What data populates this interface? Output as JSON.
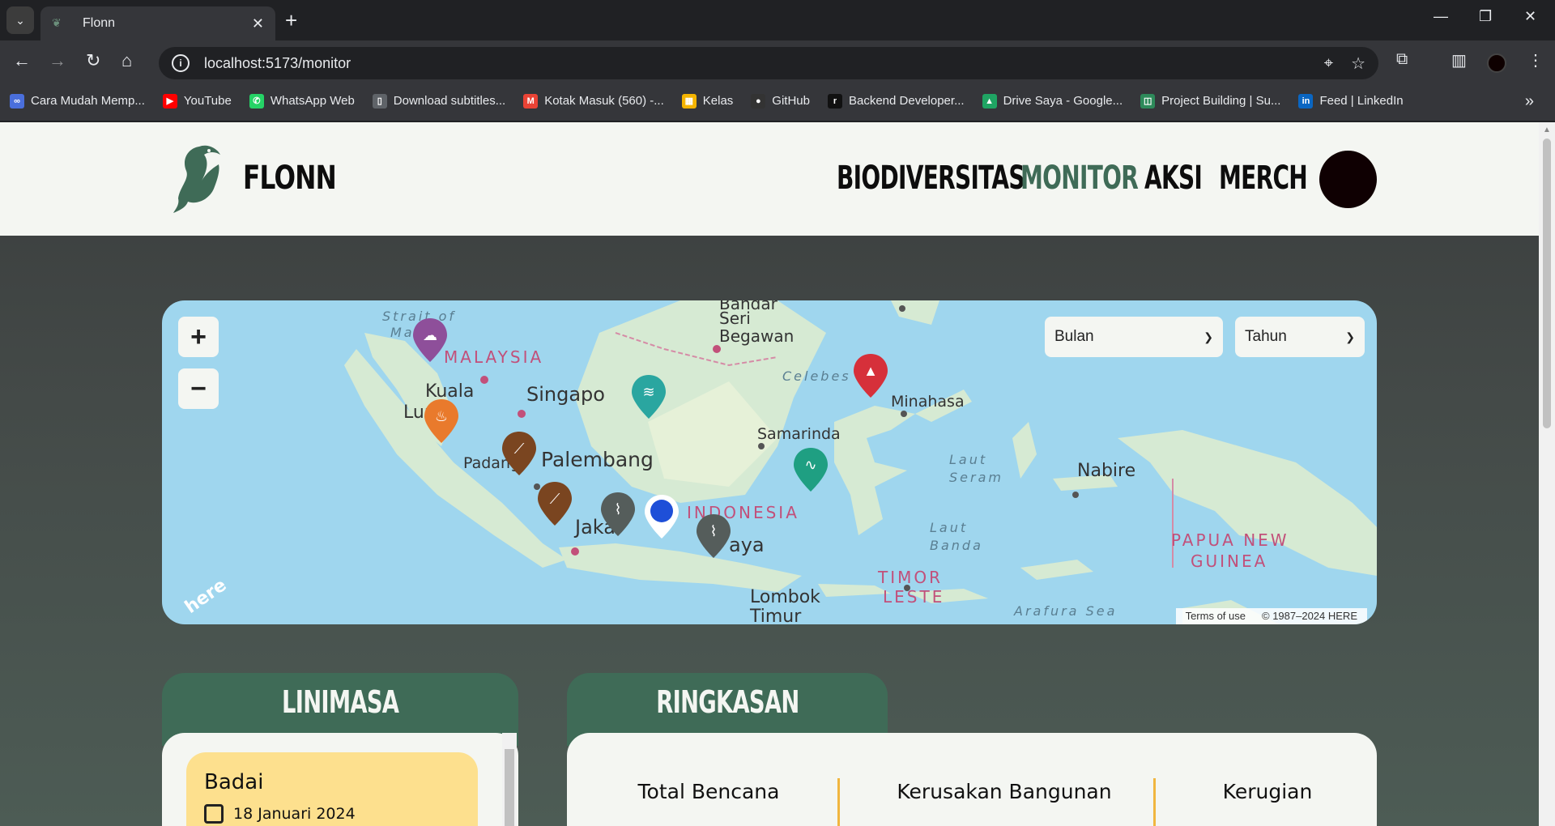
{
  "browser": {
    "tab_title": "Flonn",
    "url": "localhost:5173/monitor",
    "bookmarks": [
      {
        "label": "Cara Mudah Memp...",
        "icon": "link-icon",
        "color": "#4a6fdc"
      },
      {
        "label": "YouTube",
        "icon": "youtube-icon",
        "color": "#ff0000"
      },
      {
        "label": "WhatsApp Web",
        "icon": "whatsapp-icon",
        "color": "#25d366"
      },
      {
        "label": "Download subtitles...",
        "icon": "page-icon",
        "color": "#5f6368"
      },
      {
        "label": "Kotak Masuk (560) -...",
        "icon": "gmail-icon",
        "color": "#ea4335"
      },
      {
        "label": "Kelas",
        "icon": "classroom-icon",
        "color": "#f4b400"
      },
      {
        "label": "GitHub",
        "icon": "github-icon",
        "color": "#333333"
      },
      {
        "label": "Backend Developer...",
        "icon": "dicoding-icon",
        "color": "#111111"
      },
      {
        "label": "Drive Saya - Google...",
        "icon": "drive-icon",
        "color": "#1fa463"
      },
      {
        "label": "Project Building | Su...",
        "icon": "project-icon",
        "color": "#2d8a5a"
      },
      {
        "label": "Feed | LinkedIn",
        "icon": "linkedin-icon",
        "color": "#0a66c2"
      }
    ]
  },
  "header": {
    "brand": "FLONN",
    "nav": [
      "BIODIVERSITAS",
      "MONITOR",
      "AKSI",
      "MERCH"
    ],
    "active_nav": "MONITOR"
  },
  "map": {
    "filters": {
      "month": "Bulan",
      "year": "Tahun"
    },
    "zoom_in": "+",
    "zoom_out": "−",
    "labels": {
      "strait": "Strait of",
      "strait2": "Ma",
      "malaysia": "MALAYSIA",
      "bandar": "Bandar",
      "seri": "Seri",
      "begawan": "Begawan",
      "kuala": "Kuala",
      "lumpur": "Lum",
      "singapore": "Singapo",
      "celebes": "Celebes S",
      "minahasa": "Minahasa",
      "samarinda": "Samarinda",
      "padang": "Padang",
      "palembang": "Palembang",
      "laut_seram": "Laut Seram",
      "nabire": "Nabire",
      "indonesia": "INDONESIA",
      "jakarta": "Jaka",
      "surabaya": "aya",
      "laut_banda": "Laut Banda",
      "papua": "PAPUA NEW",
      "guinea": "GUINEA",
      "timor": "TIMOR",
      "leste": "LESTE",
      "lombok": "Lombok",
      "timur": "Timur",
      "arafura": "Arafura Sea",
      "here_logo": "here",
      "terms": "Terms of use",
      "copyright": "© 1987–2024 HERE"
    },
    "markers": [
      {
        "type": "storm",
        "color": "#8e4f9a",
        "icon": "cloud-icon"
      },
      {
        "type": "fire",
        "color": "#e97a2c",
        "icon": "fire-icon"
      },
      {
        "type": "landslide",
        "color": "#7a4520",
        "icon": "landslide-icon"
      },
      {
        "type": "flood",
        "color": "#2aa6a0",
        "icon": "flood-icon"
      },
      {
        "type": "volcano",
        "color": "#d6303a",
        "icon": "volcano-icon"
      },
      {
        "type": "tsunami",
        "color": "#1f9f82",
        "icon": "wave-icon"
      },
      {
        "type": "landslide",
        "color": "#7a4520",
        "icon": "landslide-icon"
      },
      {
        "type": "earthquake",
        "color": "#555d5b",
        "icon": "seismic-icon"
      },
      {
        "type": "user-location",
        "color": "#1e4fd8",
        "icon": "location-icon"
      },
      {
        "type": "earthquake",
        "color": "#555d5b",
        "icon": "seismic-icon"
      }
    ]
  },
  "timeline": {
    "title": "LINIMASA",
    "cards": [
      {
        "title": "Badai",
        "date": "18 Januari 2024"
      }
    ]
  },
  "summary": {
    "title": "RINGKASAN",
    "stats": [
      "Total Bencana",
      "Kerusakan Bangunan",
      "Kerugian"
    ]
  },
  "colors": {
    "brand_green": "#3f6b57",
    "card_yellow": "#fde08e",
    "accent": "#f0b640"
  }
}
